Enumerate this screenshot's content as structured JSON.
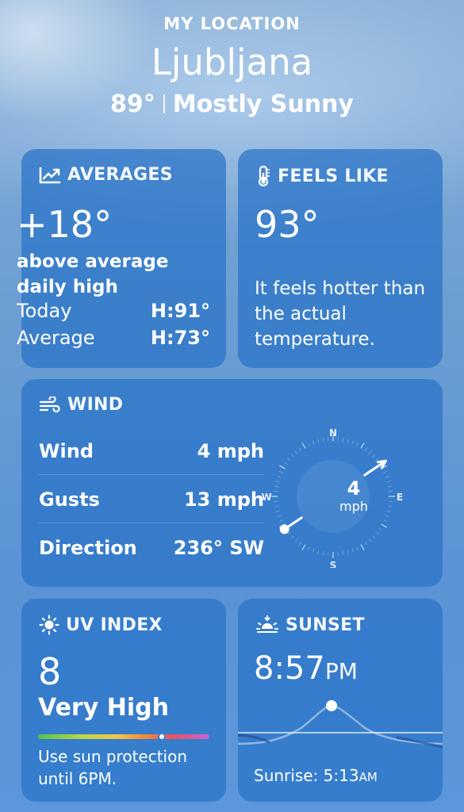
{
  "header": {
    "location_label": "MY LOCATION",
    "city": "Ljubljana",
    "temperature": "89°",
    "condition": "Mostly Sunny"
  },
  "averages": {
    "title": "AVERAGES",
    "icon": "chart-line-icon",
    "delta": "+18°",
    "description": "above average daily high",
    "rows": [
      {
        "label": "Today",
        "value": "H:91°"
      },
      {
        "label": "Average",
        "value": "H:73°"
      }
    ]
  },
  "feels_like": {
    "title": "FEELS LIKE",
    "icon": "thermometer-icon",
    "value": "93°",
    "description": "It feels hotter than the actual temperature."
  },
  "wind": {
    "title": "WIND",
    "icon": "wind-icon",
    "rows": [
      {
        "label": "Wind",
        "value": "4 mph"
      },
      {
        "label": "Gusts",
        "value": "13 mph"
      },
      {
        "label": "Direction",
        "value": "236° SW"
      }
    ],
    "compass": {
      "speed": "4",
      "unit": "mph",
      "north": "N",
      "east": "E",
      "south": "S",
      "west": "W",
      "direction_degrees": 236
    }
  },
  "uv_index": {
    "title": "UV INDEX",
    "icon": "sun-icon",
    "value": "8",
    "level": "Very High",
    "level_fraction": 0.72,
    "description": "Use sun protection until 6PM."
  },
  "sunset": {
    "title": "SUNSET",
    "icon": "sunset-icon",
    "time": "8:57",
    "time_ampm": "PM",
    "sunrise_label": "Sunrise: 5:13",
    "sunrise_ampm": "AM"
  }
}
